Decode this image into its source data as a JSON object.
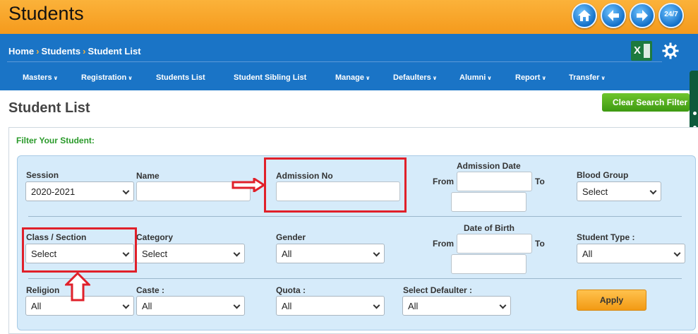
{
  "header": {
    "title": "Students",
    "support_label": "24/7"
  },
  "breadcrumb": [
    "Home",
    "Students",
    "Student List"
  ],
  "excel_label": "X",
  "nav": [
    {
      "label": "Masters",
      "chev": "∨"
    },
    {
      "label": "Registration",
      "chev": "∨"
    },
    {
      "label": "Students List",
      "chev": ""
    },
    {
      "label": "Student Sibling List",
      "chev": ""
    },
    {
      "label": "Manage",
      "chev": "∨"
    },
    {
      "label": "Defaulters",
      "chev": "∨"
    },
    {
      "label": "Alumni",
      "chev": "∨"
    },
    {
      "label": "Report",
      "chev": "∨"
    },
    {
      "label": "Transfer",
      "chev": "∨"
    }
  ],
  "page": {
    "title": "Student List",
    "clear_filter": "Clear Search Filter"
  },
  "filter": {
    "title": "Filter Your Student:",
    "session": {
      "label": "Session",
      "value": "2020-2021"
    },
    "name": {
      "label": "Name",
      "value": ""
    },
    "admission_no": {
      "label": "Admission No",
      "value": ""
    },
    "admission_date": {
      "label": "Admission Date",
      "from": "From",
      "to": "To"
    },
    "blood_group": {
      "label": "Blood Group",
      "value": "Select"
    },
    "class_section": {
      "label": "Class / Section",
      "value": "Select"
    },
    "category": {
      "label": "Category",
      "value": "Select"
    },
    "gender": {
      "label": "Gender",
      "value": "All"
    },
    "date_of_birth": {
      "label": "Date of Birth",
      "from": "From",
      "to": "To"
    },
    "student_type": {
      "label": "Student Type :",
      "value": "All"
    },
    "religion": {
      "label": "Religion",
      "value": "All"
    },
    "caste": {
      "label": "Caste :",
      "value": "All"
    },
    "quota": {
      "label": "Quota :",
      "value": "All"
    },
    "defaulter": {
      "label": "Select Defaulter :",
      "value": "All"
    },
    "apply": "Apply"
  },
  "colors": {
    "header_orange": "#f5a01f",
    "nav_blue": "#1a74c6",
    "panel_blue": "#d6ebfa",
    "annotation_red": "#e0202a",
    "clear_green": "#4ca41a"
  }
}
